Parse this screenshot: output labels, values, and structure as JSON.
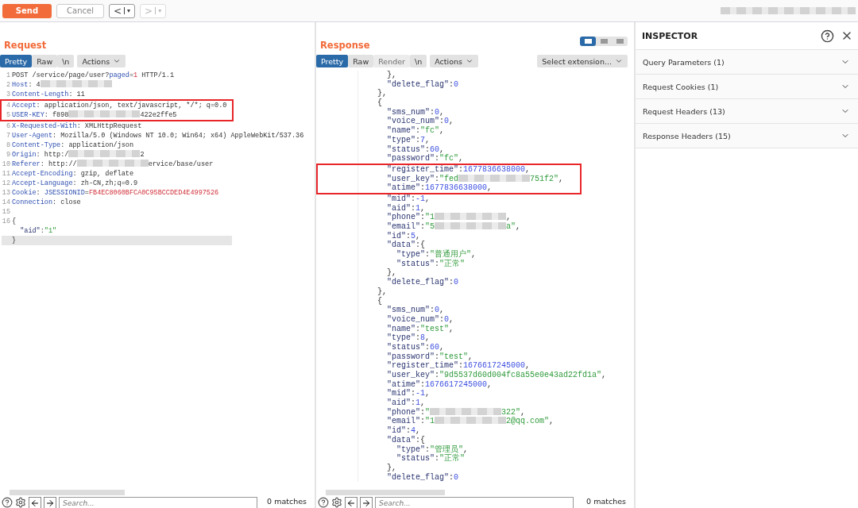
{
  "toolbar": {
    "send": "Send",
    "cancel": "Cancel",
    "back": {
      "label": "<",
      "menu": "▾",
      "disabled": false
    },
    "forward": {
      "label": ">",
      "menu": "▾",
      "disabled": true
    }
  },
  "request": {
    "title": "Request",
    "tabs": [
      {
        "label": "Pretty",
        "selected": true,
        "disabled": false
      },
      {
        "label": "Raw",
        "selected": false,
        "disabled": false
      },
      {
        "label": "\\n",
        "selected": false,
        "disabled": false
      }
    ],
    "actions": "Actions",
    "blocks": [
      {
        "highlighted": false,
        "lines": [
          {
            "number": "1",
            "current": false,
            "tokens": [
              {
                "kind": "plain",
                "text": "POST /service/page/user?"
              },
              {
                "kind": "name",
                "text": "paged"
              },
              {
                "kind": "plain",
                "text": "="
              },
              {
                "kind": "cookie_value",
                "text": "1"
              },
              {
                "kind": "plain",
                "text": " HTTP/1.1"
              }
            ]
          },
          {
            "number": "2",
            "current": false,
            "tokens": [
              {
                "kind": "name",
                "text": "Host"
              },
              {
                "kind": "plain",
                "text": ": 4"
              },
              {
                "kind": "redacted"
              }
            ]
          },
          {
            "number": "3",
            "current": false,
            "tokens": [
              {
                "kind": "name",
                "text": "Content-Length"
              },
              {
                "kind": "plain",
                "text": ": 11"
              }
            ]
          }
        ]
      },
      {
        "highlighted": true,
        "lines": [
          {
            "number": "4",
            "current": false,
            "tokens": [
              {
                "kind": "name",
                "text": "Accept"
              },
              {
                "kind": "plain",
                "text": ": application/json, text/javascript, */*; q=0.0"
              }
            ]
          },
          {
            "number": "5",
            "current": false,
            "tokens": [
              {
                "kind": "name",
                "text": "USER-KEY"
              },
              {
                "kind": "plain",
                "text": ": f898"
              },
              {
                "kind": "redacted"
              },
              {
                "kind": "plain",
                "text": "422e2ffe5"
              }
            ]
          }
        ]
      },
      {
        "highlighted": false,
        "lines": [
          {
            "number": "6",
            "current": false,
            "tokens": [
              {
                "kind": "name",
                "text": "X-Requested-With"
              },
              {
                "kind": "plain",
                "text": ": XMLHttpRequest"
              }
            ]
          },
          {
            "number": "7",
            "current": false,
            "tokens": [
              {
                "kind": "name",
                "text": "User-Agent"
              },
              {
                "kind": "plain",
                "text": ": Mozilla/5.0 (Windows NT 10.0; Win64; x64) AppleWebKit/537.36"
              }
            ]
          },
          {
            "number": "8",
            "current": false,
            "tokens": [
              {
                "kind": "name",
                "text": "Content-Type"
              },
              {
                "kind": "plain",
                "text": ": application/json"
              }
            ]
          },
          {
            "number": "9",
            "current": false,
            "tokens": [
              {
                "kind": "name",
                "text": "Origin"
              },
              {
                "kind": "plain",
                "text": ": http:/"
              },
              {
                "kind": "redacted"
              },
              {
                "kind": "plain",
                "text": "2"
              }
            ]
          },
          {
            "number": "10",
            "current": false,
            "tokens": [
              {
                "kind": "name",
                "text": "Referer"
              },
              {
                "kind": "plain",
                "text": ": http://"
              },
              {
                "kind": "redacted"
              },
              {
                "kind": "plain",
                "text": "ervice/base/user"
              }
            ]
          },
          {
            "number": "11",
            "current": false,
            "tokens": [
              {
                "kind": "name",
                "text": "Accept-Encoding"
              },
              {
                "kind": "plain",
                "text": ": gzip, deflate"
              }
            ]
          },
          {
            "number": "12",
            "current": false,
            "tokens": [
              {
                "kind": "name",
                "text": "Accept-Language"
              },
              {
                "kind": "plain",
                "text": ": zh-CN,zh;q=0.9"
              }
            ]
          },
          {
            "number": "13",
            "current": false,
            "tokens": [
              {
                "kind": "name",
                "text": "Cookie"
              },
              {
                "kind": "plain",
                "text": ": "
              },
              {
                "kind": "name",
                "text": "JSESSIONID"
              },
              {
                "kind": "plain",
                "text": "="
              },
              {
                "kind": "cookie_value",
                "text": "FB4EC8060BFCA0C95BCCDED4E4997526"
              }
            ]
          },
          {
            "number": "14",
            "current": false,
            "tokens": [
              {
                "kind": "name",
                "text": "Connection"
              },
              {
                "kind": "plain",
                "text": ": close"
              }
            ]
          },
          {
            "number": "15",
            "current": false
          },
          {
            "number": "16",
            "current": false,
            "tokens": [
              {
                "kind": "plain",
                "text": "{"
              }
            ]
          },
          {
            "current": false,
            "tokens": [
              {
                "kind": "key",
                "text": "  \"aid\""
              },
              {
                "kind": "plain",
                "text": ":"
              },
              {
                "kind": "string",
                "text": "\"1\""
              }
            ]
          },
          {
            "current": true,
            "tokens": [
              {
                "kind": "plain",
                "text": "}"
              }
            ]
          }
        ]
      }
    ],
    "search": {
      "placeholder": "Search...",
      "matches": "0 matches"
    }
  },
  "response": {
    "title": "Response",
    "views": [
      {
        "selected": true
      },
      {
        "selected": false
      },
      {
        "selected": false
      }
    ],
    "tabs": [
      {
        "label": "Pretty",
        "selected": true,
        "disabled": false
      },
      {
        "label": "Raw",
        "selected": false,
        "disabled": false
      },
      {
        "label": "Render",
        "selected": false,
        "disabled": true
      },
      {
        "label": "\\n",
        "selected": false,
        "disabled": false
      }
    ],
    "actions": "Actions",
    "extension": "Select extension...",
    "blocks": [
      {
        "highlighted": false,
        "lines": [
          {
            "tokens": [
              {
                "kind": "plain",
                "text": "      },"
              }
            ]
          },
          {
            "tokens": [
              {
                "kind": "key",
                "text": "      \"delete_flag\""
              },
              {
                "kind": "plain",
                "text": ":"
              },
              {
                "kind": "number",
                "text": "0"
              }
            ]
          },
          {
            "tokens": [
              {
                "kind": "plain",
                "text": "    },"
              }
            ]
          },
          {
            "tokens": [
              {
                "kind": "plain",
                "text": "    {"
              }
            ]
          },
          {
            "tokens": [
              {
                "kind": "key",
                "text": "      \"sms_num\""
              },
              {
                "kind": "plain",
                "text": ":"
              },
              {
                "kind": "number",
                "text": "0"
              },
              {
                "kind": "plain",
                "text": ","
              }
            ]
          },
          {
            "tokens": [
              {
                "kind": "key",
                "text": "      \"voice_num\""
              },
              {
                "kind": "plain",
                "text": ":"
              },
              {
                "kind": "number",
                "text": "0"
              },
              {
                "kind": "plain",
                "text": ","
              }
            ]
          },
          {
            "tokens": [
              {
                "kind": "key",
                "text": "      \"name\""
              },
              {
                "kind": "plain",
                "text": ":"
              },
              {
                "kind": "string",
                "text": "\"fc\""
              },
              {
                "kind": "plain",
                "text": ","
              }
            ]
          },
          {
            "tokens": [
              {
                "kind": "key",
                "text": "      \"type\""
              },
              {
                "kind": "plain",
                "text": ":"
              },
              {
                "kind": "number",
                "text": "7"
              },
              {
                "kind": "plain",
                "text": ","
              }
            ]
          },
          {
            "tokens": [
              {
                "kind": "key",
                "text": "      \"status\""
              },
              {
                "kind": "plain",
                "text": ":"
              },
              {
                "kind": "number",
                "text": "60"
              },
              {
                "kind": "plain",
                "text": ","
              }
            ]
          },
          {
            "tokens": [
              {
                "kind": "key",
                "text": "      \"password\""
              },
              {
                "kind": "plain",
                "text": ":"
              },
              {
                "kind": "string",
                "text": "\"fc\""
              },
              {
                "kind": "plain",
                "text": ","
              }
            ]
          }
        ]
      },
      {
        "highlighted": true,
        "lines": [
          {
            "tokens": [
              {
                "kind": "key",
                "text": "      \"register_time\""
              },
              {
                "kind": "plain",
                "text": ":"
              },
              {
                "kind": "number",
                "text": "1677836638000"
              },
              {
                "kind": "plain",
                "text": ","
              }
            ]
          },
          {
            "tokens": [
              {
                "kind": "key",
                "text": "      \"user_key\""
              },
              {
                "kind": "plain",
                "text": ":"
              },
              {
                "kind": "string",
                "text": "\"fed"
              },
              {
                "kind": "redacted"
              },
              {
                "kind": "string",
                "text": "751f2\""
              },
              {
                "kind": "plain",
                "text": ","
              }
            ]
          },
          {
            "tokens": [
              {
                "kind": "key",
                "text": "      \"atime\""
              },
              {
                "kind": "plain",
                "text": ":"
              },
              {
                "kind": "number",
                "text": "1677836638000"
              },
              {
                "kind": "plain",
                "text": ","
              }
            ]
          }
        ]
      },
      {
        "highlighted": false,
        "lines": [
          {
            "tokens": [
              {
                "kind": "key",
                "text": "      \"mid\""
              },
              {
                "kind": "plain",
                "text": ":"
              },
              {
                "kind": "number",
                "text": "-1"
              },
              {
                "kind": "plain",
                "text": ","
              }
            ]
          },
          {
            "tokens": [
              {
                "kind": "key",
                "text": "      \"aid\""
              },
              {
                "kind": "plain",
                "text": ":"
              },
              {
                "kind": "number",
                "text": "1"
              },
              {
                "kind": "plain",
                "text": ","
              }
            ]
          },
          {
            "tokens": [
              {
                "kind": "key",
                "text": "      \"phone\""
              },
              {
                "kind": "plain",
                "text": ":"
              },
              {
                "kind": "string",
                "text": "\"1"
              },
              {
                "kind": "redacted"
              },
              {
                "kind": "plain",
                "text": ","
              }
            ]
          },
          {
            "tokens": [
              {
                "kind": "key",
                "text": "      \"email\""
              },
              {
                "kind": "plain",
                "text": ":"
              },
              {
                "kind": "string",
                "text": "\"5"
              },
              {
                "kind": "redacted"
              },
              {
                "kind": "string",
                "text": "a\""
              },
              {
                "kind": "plain",
                "text": ","
              }
            ]
          },
          {
            "tokens": [
              {
                "kind": "key",
                "text": "      \"id\""
              },
              {
                "kind": "plain",
                "text": ":"
              },
              {
                "kind": "number",
                "text": "5"
              },
              {
                "kind": "plain",
                "text": ","
              }
            ]
          },
          {
            "tokens": [
              {
                "kind": "key",
                "text": "      \"data\""
              },
              {
                "kind": "plain",
                "text": ":{"
              }
            ]
          },
          {
            "tokens": [
              {
                "kind": "key",
                "text": "        \"type\""
              },
              {
                "kind": "plain",
                "text": ":"
              },
              {
                "kind": "string",
                "text": "\"普通用户\""
              },
              {
                "kind": "plain",
                "text": ","
              }
            ]
          },
          {
            "tokens": [
              {
                "kind": "key",
                "text": "        \"status\""
              },
              {
                "kind": "plain",
                "text": ":"
              },
              {
                "kind": "string",
                "text": "\"正常\""
              }
            ]
          },
          {
            "tokens": [
              {
                "kind": "plain",
                "text": "      },"
              }
            ]
          },
          {
            "tokens": [
              {
                "kind": "key",
                "text": "      \"delete_flag\""
              },
              {
                "kind": "plain",
                "text": ":"
              },
              {
                "kind": "number",
                "text": "0"
              }
            ]
          },
          {
            "tokens": [
              {
                "kind": "plain",
                "text": "    },"
              }
            ]
          },
          {
            "tokens": [
              {
                "kind": "plain",
                "text": "    {"
              }
            ]
          },
          {
            "tokens": [
              {
                "kind": "key",
                "text": "      \"sms_num\""
              },
              {
                "kind": "plain",
                "text": ":"
              },
              {
                "kind": "number",
                "text": "0"
              },
              {
                "kind": "plain",
                "text": ","
              }
            ]
          },
          {
            "tokens": [
              {
                "kind": "key",
                "text": "      \"voice_num\""
              },
              {
                "kind": "plain",
                "text": ":"
              },
              {
                "kind": "number",
                "text": "0"
              },
              {
                "kind": "plain",
                "text": ","
              }
            ]
          },
          {
            "tokens": [
              {
                "kind": "key",
                "text": "      \"name\""
              },
              {
                "kind": "plain",
                "text": ":"
              },
              {
                "kind": "string",
                "text": "\"test\""
              },
              {
                "kind": "plain",
                "text": ","
              }
            ]
          },
          {
            "tokens": [
              {
                "kind": "key",
                "text": "      \"type\""
              },
              {
                "kind": "plain",
                "text": ":"
              },
              {
                "kind": "number",
                "text": "8"
              },
              {
                "kind": "plain",
                "text": ","
              }
            ]
          },
          {
            "tokens": [
              {
                "kind": "key",
                "text": "      \"status\""
              },
              {
                "kind": "plain",
                "text": ":"
              },
              {
                "kind": "number",
                "text": "60"
              },
              {
                "kind": "plain",
                "text": ","
              }
            ]
          },
          {
            "tokens": [
              {
                "kind": "key",
                "text": "      \"password\""
              },
              {
                "kind": "plain",
                "text": ":"
              },
              {
                "kind": "string",
                "text": "\"test\""
              },
              {
                "kind": "plain",
                "text": ","
              }
            ]
          },
          {
            "tokens": [
              {
                "kind": "key",
                "text": "      \"register_time\""
              },
              {
                "kind": "plain",
                "text": ":"
              },
              {
                "kind": "number",
                "text": "1676617245000"
              },
              {
                "kind": "plain",
                "text": ","
              }
            ]
          },
          {
            "tokens": [
              {
                "kind": "key",
                "text": "      \"user_key\""
              },
              {
                "kind": "plain",
                "text": ":"
              },
              {
                "kind": "string",
                "text": "\"9d5537d60d004fc8a55e0e43ad22fd1a\""
              },
              {
                "kind": "plain",
                "text": ","
              }
            ]
          },
          {
            "tokens": [
              {
                "kind": "key",
                "text": "      \"atime\""
              },
              {
                "kind": "plain",
                "text": ":"
              },
              {
                "kind": "number",
                "text": "1676617245000"
              },
              {
                "kind": "plain",
                "text": ","
              }
            ]
          },
          {
            "tokens": [
              {
                "kind": "key",
                "text": "      \"mid\""
              },
              {
                "kind": "plain",
                "text": ":"
              },
              {
                "kind": "number",
                "text": "-1"
              },
              {
                "kind": "plain",
                "text": ","
              }
            ]
          },
          {
            "tokens": [
              {
                "kind": "key",
                "text": "      \"aid\""
              },
              {
                "kind": "plain",
                "text": ":"
              },
              {
                "kind": "number",
                "text": "1"
              },
              {
                "kind": "plain",
                "text": ","
              }
            ]
          },
          {
            "tokens": [
              {
                "kind": "key",
                "text": "      \"phone\""
              },
              {
                "kind": "plain",
                "text": ":"
              },
              {
                "kind": "string",
                "text": "\""
              },
              {
                "kind": "redacted"
              },
              {
                "kind": "string",
                "text": "322\""
              },
              {
                "kind": "plain",
                "text": ","
              }
            ]
          },
          {
            "tokens": [
              {
                "kind": "key",
                "text": "      \"email\""
              },
              {
                "kind": "plain",
                "text": ":"
              },
              {
                "kind": "string",
                "text": "\"1"
              },
              {
                "kind": "redacted"
              },
              {
                "kind": "string",
                "text": "2@qq.com\""
              },
              {
                "kind": "plain",
                "text": ","
              }
            ]
          },
          {
            "tokens": [
              {
                "kind": "key",
                "text": "      \"id\""
              },
              {
                "kind": "plain",
                "text": ":"
              },
              {
                "kind": "number",
                "text": "4"
              },
              {
                "kind": "plain",
                "text": ","
              }
            ]
          },
          {
            "tokens": [
              {
                "kind": "key",
                "text": "      \"data\""
              },
              {
                "kind": "plain",
                "text": ":{"
              }
            ]
          },
          {
            "tokens": [
              {
                "kind": "key",
                "text": "        \"type\""
              },
              {
                "kind": "plain",
                "text": ":"
              },
              {
                "kind": "string",
                "text": "\"管理员\""
              },
              {
                "kind": "plain",
                "text": ","
              }
            ]
          },
          {
            "tokens": [
              {
                "kind": "key",
                "text": "        \"status\""
              },
              {
                "kind": "plain",
                "text": ":"
              },
              {
                "kind": "string",
                "text": "\"正常\""
              }
            ]
          },
          {
            "tokens": [
              {
                "kind": "plain",
                "text": "      },"
              }
            ]
          },
          {
            "tokens": [
              {
                "kind": "key",
                "text": "      \"delete_flag\""
              },
              {
                "kind": "plain",
                "text": ":"
              },
              {
                "kind": "number",
                "text": "0"
              }
            ]
          }
        ]
      }
    ],
    "search": {
      "placeholder": "Search...",
      "matches": "0 matches"
    }
  },
  "inspector": {
    "title": "INSPECTOR",
    "sections": [
      {
        "label": "Query Parameters (1)",
        "expanded": false
      },
      {
        "label": "Request Cookies (1)",
        "expanded": false
      },
      {
        "label": "Request Headers (13)",
        "expanded": false
      },
      {
        "label": "Response Headers (15)",
        "expanded": false
      }
    ]
  }
}
